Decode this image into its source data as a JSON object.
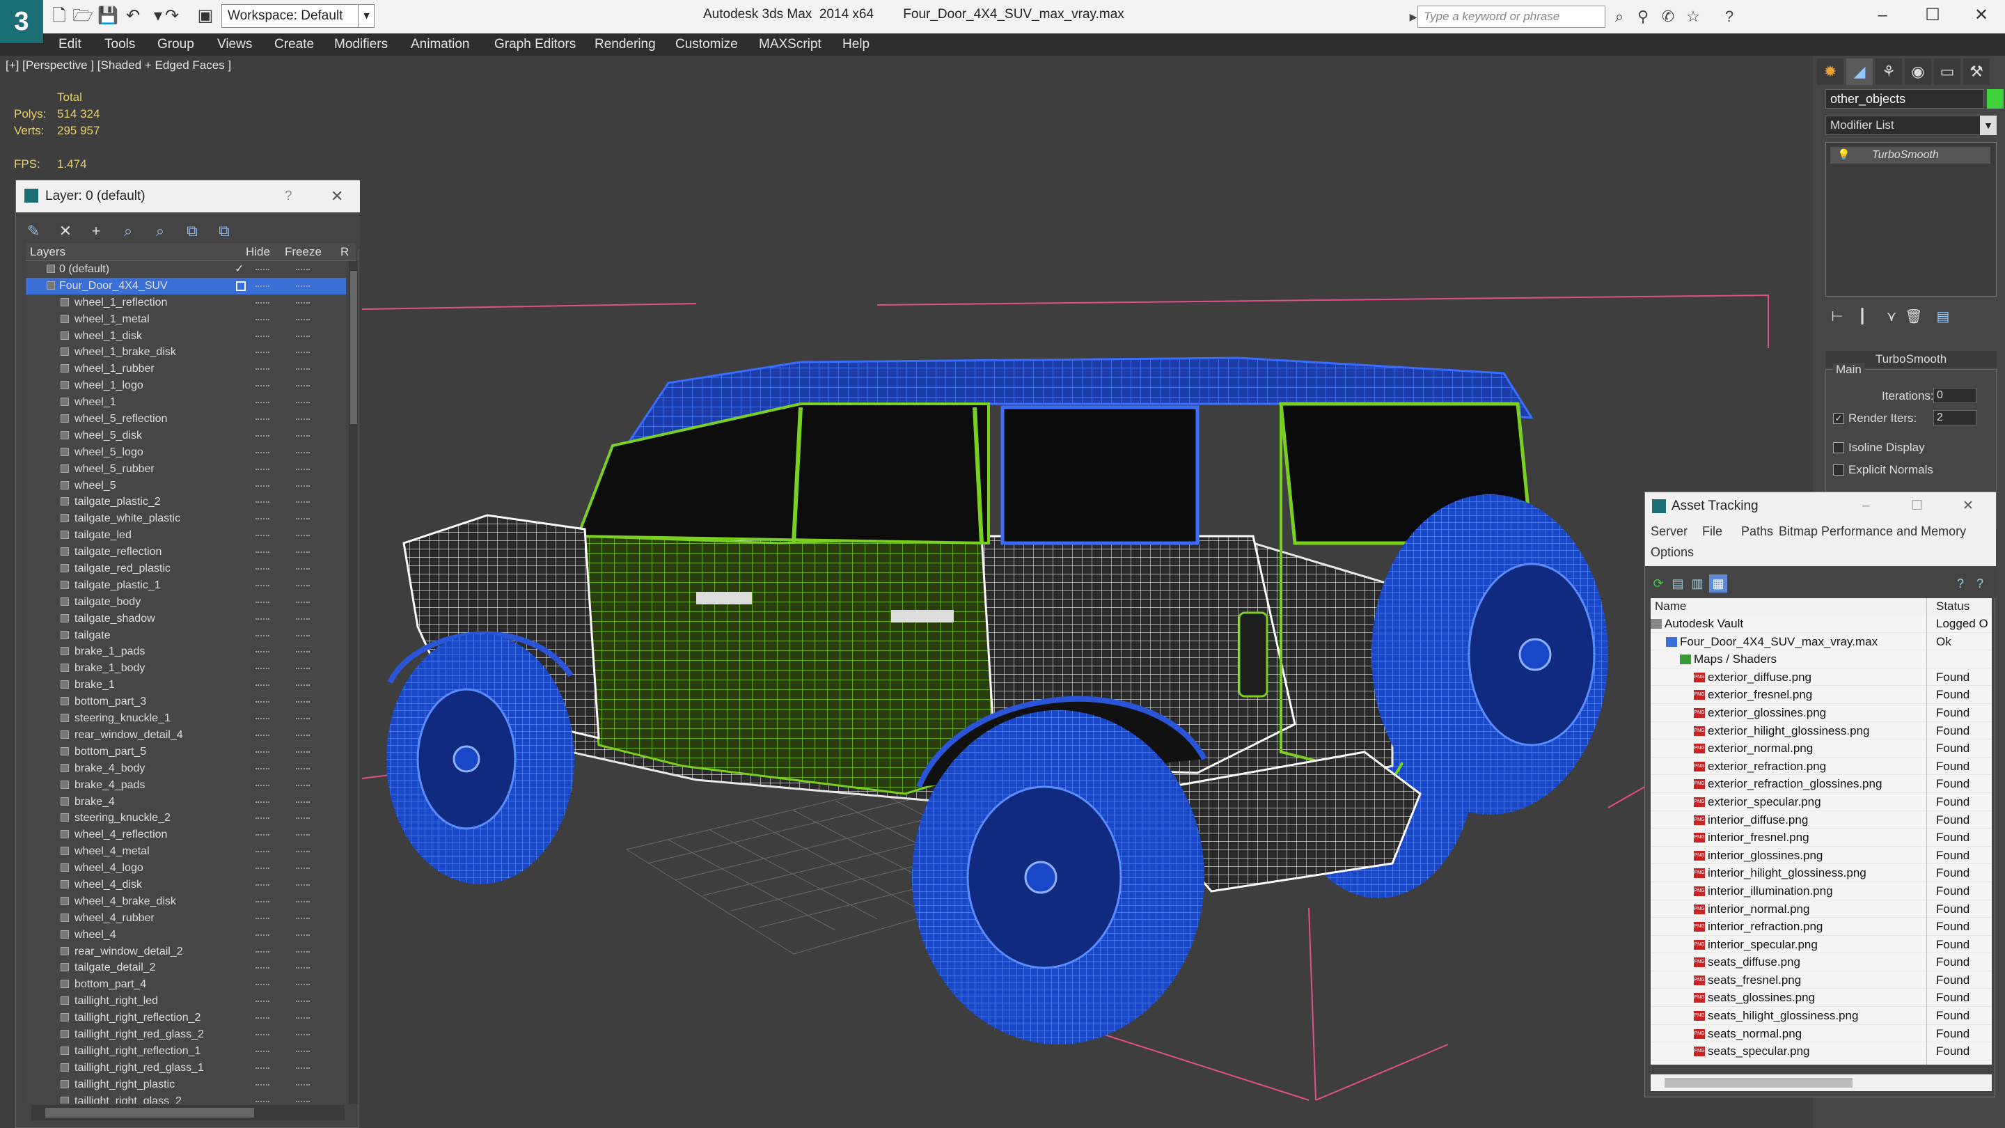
{
  "app": {
    "title": "Autodesk 3ds Max  2014 x64",
    "file": "Four_Door_4X4_SUV_max_vray.max",
    "workspace": "Workspace: Default",
    "search_placeholder": "Type a keyword or phrase",
    "logo": "3"
  },
  "menu": [
    "Edit",
    "Tools",
    "Group",
    "Views",
    "Create",
    "Modifiers",
    "Animation",
    "Graph Editors",
    "Rendering",
    "Customize",
    "MAXScript",
    "Help"
  ],
  "viewport": {
    "label": "[+] [Perspective ] [Shaded + Edged Faces ]",
    "stats": {
      "total_label": "Total",
      "polys_label": "Polys:",
      "polys": "514 324",
      "verts_label": "Verts:",
      "verts": "295 957",
      "fps_label": "FPS:",
      "fps": "1.474"
    }
  },
  "layer_window": {
    "title": "Layer: 0 (default)",
    "help": "?",
    "close": "✕",
    "columns": {
      "layers": "Layers",
      "hide": "Hide",
      "freeze": "Freeze",
      "r": "R"
    },
    "rows": [
      {
        "name": "0 (default)",
        "level": 0,
        "checked": true
      },
      {
        "name": "Four_Door_4X4_SUV",
        "level": 0,
        "selected": true
      },
      {
        "name": "wheel_1_reflection",
        "level": 1
      },
      {
        "name": "wheel_1_metal",
        "level": 1
      },
      {
        "name": "wheel_1_disk",
        "level": 1
      },
      {
        "name": "wheel_1_brake_disk",
        "level": 1
      },
      {
        "name": "wheel_1_rubber",
        "level": 1
      },
      {
        "name": "wheel_1_logo",
        "level": 1
      },
      {
        "name": "wheel_1",
        "level": 1
      },
      {
        "name": "wheel_5_reflection",
        "level": 1
      },
      {
        "name": "wheel_5_disk",
        "level": 1
      },
      {
        "name": "wheel_5_logo",
        "level": 1
      },
      {
        "name": "wheel_5_rubber",
        "level": 1
      },
      {
        "name": "wheel_5",
        "level": 1
      },
      {
        "name": "tailgate_plastic_2",
        "level": 1
      },
      {
        "name": "tailgate_white_plastic",
        "level": 1
      },
      {
        "name": "tailgate_led",
        "level": 1
      },
      {
        "name": "tailgate_reflection",
        "level": 1
      },
      {
        "name": "tailgate_red_plastic",
        "level": 1
      },
      {
        "name": "tailgate_plastic_1",
        "level": 1
      },
      {
        "name": "tailgate_body",
        "level": 1
      },
      {
        "name": "tailgate_shadow",
        "level": 1
      },
      {
        "name": "tailgate",
        "level": 1
      },
      {
        "name": "brake_1_pads",
        "level": 1
      },
      {
        "name": "brake_1_body",
        "level": 1
      },
      {
        "name": "brake_1",
        "level": 1
      },
      {
        "name": "bottom_part_3",
        "level": 1
      },
      {
        "name": "steering_knuckle_1",
        "level": 1
      },
      {
        "name": "rear_window_detail_4",
        "level": 1
      },
      {
        "name": "bottom_part_5",
        "level": 1
      },
      {
        "name": "brake_4_body",
        "level": 1
      },
      {
        "name": "brake_4_pads",
        "level": 1
      },
      {
        "name": "brake_4",
        "level": 1
      },
      {
        "name": "steering_knuckle_2",
        "level": 1
      },
      {
        "name": "wheel_4_reflection",
        "level": 1
      },
      {
        "name": "wheel_4_metal",
        "level": 1
      },
      {
        "name": "wheel_4_logo",
        "level": 1
      },
      {
        "name": "wheel_4_disk",
        "level": 1
      },
      {
        "name": "wheel_4_brake_disk",
        "level": 1
      },
      {
        "name": "wheel_4_rubber",
        "level": 1
      },
      {
        "name": "wheel_4",
        "level": 1
      },
      {
        "name": "rear_window_detail_2",
        "level": 1
      },
      {
        "name": "tailgate_detail_2",
        "level": 1
      },
      {
        "name": "bottom_part_4",
        "level": 1
      },
      {
        "name": "taillight_right_led",
        "level": 1
      },
      {
        "name": "taillight_right_reflection_2",
        "level": 1
      },
      {
        "name": "taillight_right_red_glass_2",
        "level": 1
      },
      {
        "name": "taillight_right_reflection_1",
        "level": 1
      },
      {
        "name": "taillight_right_red_glass_1",
        "level": 1
      },
      {
        "name": "taillight_right_plastic",
        "level": 1
      },
      {
        "name": "taillight_right_glass_2",
        "level": 1
      }
    ]
  },
  "command_panel": {
    "object_name": "other_objects",
    "object_color": "#3fd23a",
    "modifier_list": "Modifier List",
    "stack_item": "TurboSmooth",
    "rollout": "TurboSmooth",
    "group": "Main",
    "iterations_label": "Iterations:",
    "iterations": "0",
    "render_iters_label": "Render Iters:",
    "render_iters": "2",
    "isoline_label": "Isoline Display",
    "explicit_label": "Explicit Normals"
  },
  "asset_tracking": {
    "title": "Asset Tracking",
    "menu": [
      "Server",
      "File",
      "Paths",
      "Bitmap Performance and Memory",
      "Options"
    ],
    "columns": {
      "name": "Name",
      "status": "Status"
    },
    "rows": [
      {
        "name": "Autodesk Vault",
        "status": "Logged O",
        "level": 0,
        "icon": "vault"
      },
      {
        "name": "Four_Door_4X4_SUV_max_vray.max",
        "status": "Ok",
        "level": 1,
        "icon": "max"
      },
      {
        "name": "Maps / Shaders",
        "status": "",
        "level": 2,
        "icon": "maps"
      },
      {
        "name": "exterior_diffuse.png",
        "status": "Found",
        "level": 3,
        "icon": "png"
      },
      {
        "name": "exterior_fresnel.png",
        "status": "Found",
        "level": 3,
        "icon": "png"
      },
      {
        "name": "exterior_glossines.png",
        "status": "Found",
        "level": 3,
        "icon": "png"
      },
      {
        "name": "exterior_hilight_glossiness.png",
        "status": "Found",
        "level": 3,
        "icon": "png"
      },
      {
        "name": "exterior_normal.png",
        "status": "Found",
        "level": 3,
        "icon": "png"
      },
      {
        "name": "exterior_refraction.png",
        "status": "Found",
        "level": 3,
        "icon": "png"
      },
      {
        "name": "exterior_refraction_glossines.png",
        "status": "Found",
        "level": 3,
        "icon": "png"
      },
      {
        "name": "exterior_specular.png",
        "status": "Found",
        "level": 3,
        "icon": "png"
      },
      {
        "name": "interior_diffuse.png",
        "status": "Found",
        "level": 3,
        "icon": "png"
      },
      {
        "name": "interior_fresnel.png",
        "status": "Found",
        "level": 3,
        "icon": "png"
      },
      {
        "name": "interior_glossines.png",
        "status": "Found",
        "level": 3,
        "icon": "png"
      },
      {
        "name": "interior_hilight_glossiness.png",
        "status": "Found",
        "level": 3,
        "icon": "png"
      },
      {
        "name": "interior_illumination.png",
        "status": "Found",
        "level": 3,
        "icon": "png"
      },
      {
        "name": "interior_normal.png",
        "status": "Found",
        "level": 3,
        "icon": "png"
      },
      {
        "name": "interior_refraction.png",
        "status": "Found",
        "level": 3,
        "icon": "png"
      },
      {
        "name": "interior_specular.png",
        "status": "Found",
        "level": 3,
        "icon": "png"
      },
      {
        "name": "seats_diffuse.png",
        "status": "Found",
        "level": 3,
        "icon": "png"
      },
      {
        "name": "seats_fresnel.png",
        "status": "Found",
        "level": 3,
        "icon": "png"
      },
      {
        "name": "seats_glossines.png",
        "status": "Found",
        "level": 3,
        "icon": "png"
      },
      {
        "name": "seats_hilight_glossiness.png",
        "status": "Found",
        "level": 3,
        "icon": "png"
      },
      {
        "name": "seats_normal.png",
        "status": "Found",
        "level": 3,
        "icon": "png"
      },
      {
        "name": "seats_specular.png",
        "status": "Found",
        "level": 3,
        "icon": "png"
      }
    ]
  },
  "colors": {
    "wire_blue": "#2a55d8",
    "wire_green": "#4fa020",
    "wire_white": "#e8e8e8",
    "selection": "#3a6fd8"
  }
}
